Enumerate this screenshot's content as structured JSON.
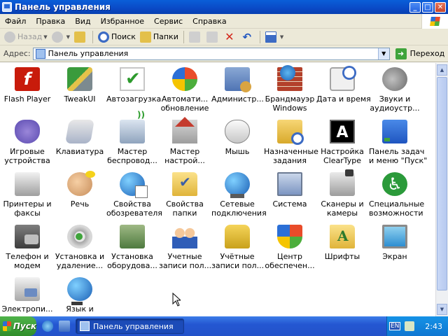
{
  "window": {
    "title": "Панель управления",
    "controls": {
      "minimize": "_",
      "maximize": "□",
      "close": "✕"
    }
  },
  "menu": [
    "Файл",
    "Правка",
    "Вид",
    "Избранное",
    "Сервис",
    "Справка"
  ],
  "toolbar": {
    "back": "Назад",
    "search": "Поиск",
    "folders": "Папки"
  },
  "address": {
    "label": "Адрес:",
    "value": "Панель управления",
    "go": "Переход"
  },
  "items": [
    {
      "l1": "Flash Player",
      "l2": "",
      "icon": "flash-player-icon"
    },
    {
      "l1": "TweakUI",
      "l2": "",
      "icon": "tweakui-icon"
    },
    {
      "l1": "Автозагрузка",
      "l2": "",
      "icon": "startup-icon"
    },
    {
      "l1": "Автомати...",
      "l2": "обновление",
      "icon": "automatic-update-icon"
    },
    {
      "l1": "Администр...",
      "l2": "",
      "icon": "administrative-tools-icon"
    },
    {
      "l1": "Брандмауэр",
      "l2": "Windows",
      "icon": "firewall-icon"
    },
    {
      "l1": "Дата и время",
      "l2": "",
      "icon": "date-time-icon"
    },
    {
      "l1": "Звуки и",
      "l2": "аудиоустр...",
      "icon": "sounds-icon"
    },
    {
      "l1": "Игровые",
      "l2": "устройства",
      "icon": "game-controllers-icon"
    },
    {
      "l1": "Клавиатура",
      "l2": "",
      "icon": "keyboard-icon"
    },
    {
      "l1": "Мастер",
      "l2": "беспровод...",
      "icon": "wireless-wizard-icon"
    },
    {
      "l1": "Мастер",
      "l2": "настрой...",
      "icon": "network-wizard-icon"
    },
    {
      "l1": "Мышь",
      "l2": "",
      "icon": "mouse-icon"
    },
    {
      "l1": "Назначенные",
      "l2": "задания",
      "icon": "scheduled-tasks-icon"
    },
    {
      "l1": "Настройка",
      "l2": "ClearType",
      "icon": "cleartype-icon"
    },
    {
      "l1": "Панель задач",
      "l2": "и меню \"Пуск\"",
      "icon": "taskbar-start-icon"
    },
    {
      "l1": "Принтеры и",
      "l2": "факсы",
      "icon": "printers-icon"
    },
    {
      "l1": "Речь",
      "l2": "",
      "icon": "speech-icon"
    },
    {
      "l1": "Свойства",
      "l2": "обозревателя",
      "icon": "internet-options-icon"
    },
    {
      "l1": "Свойства",
      "l2": "папки",
      "icon": "folder-options-icon"
    },
    {
      "l1": "Сетевые",
      "l2": "подключения",
      "icon": "network-connections-icon"
    },
    {
      "l1": "Система",
      "l2": "",
      "icon": "system-icon"
    },
    {
      "l1": "Сканеры и",
      "l2": "камеры",
      "icon": "scanners-cameras-icon"
    },
    {
      "l1": "Специальные",
      "l2": "возможности",
      "icon": "accessibility-icon"
    },
    {
      "l1": "Телефон и",
      "l2": "модем",
      "icon": "phone-modem-icon"
    },
    {
      "l1": "Установка и",
      "l2": "удаление...",
      "icon": "add-remove-programs-icon"
    },
    {
      "l1": "Установка",
      "l2": "оборудова...",
      "icon": "add-hardware-icon"
    },
    {
      "l1": "Учетные",
      "l2": "записи пол...",
      "icon": "user-accounts-icon"
    },
    {
      "l1": "Учётные",
      "l2": "записи пол...",
      "icon": "user-accounts-2-icon"
    },
    {
      "l1": "Центр",
      "l2": "обеспечен...",
      "icon": "security-center-icon"
    },
    {
      "l1": "Шрифты",
      "l2": "",
      "icon": "fonts-icon"
    },
    {
      "l1": "Экран",
      "l2": "",
      "icon": "display-icon"
    },
    {
      "l1": "Электропи...",
      "l2": "",
      "icon": "power-options-icon"
    },
    {
      "l1": "Язык и",
      "l2": "",
      "icon": "regional-language-icon"
    }
  ],
  "taskbar": {
    "start": "Пуск",
    "task": "Панель управления",
    "lang": "EN",
    "clock": "2:43"
  }
}
